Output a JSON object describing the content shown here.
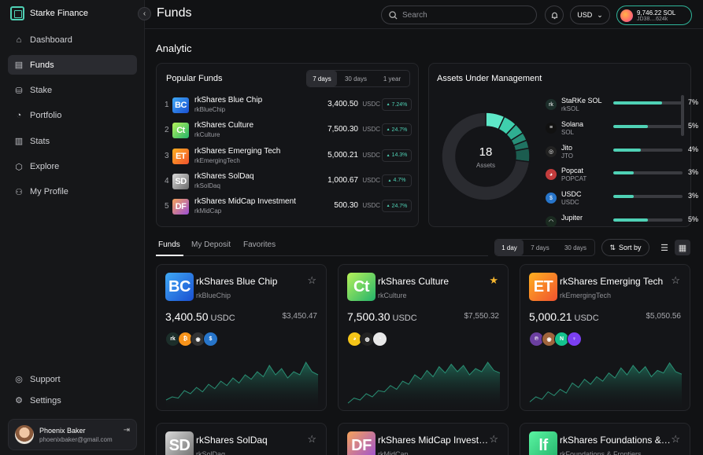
{
  "app": {
    "brand": "Starke Finance",
    "page_title": "Funds"
  },
  "sidebar": {
    "items": [
      {
        "label": "Dashboard",
        "icon": "dashboard-icon",
        "glyph": "⌂"
      },
      {
        "label": "Funds",
        "icon": "funds-icon",
        "glyph": "▤"
      },
      {
        "label": "Stake",
        "icon": "stake-icon",
        "glyph": "⛁"
      },
      {
        "label": "Portfolio",
        "icon": "portfolio-icon",
        "glyph": "◔"
      },
      {
        "label": "Stats",
        "icon": "stats-icon",
        "glyph": "▥"
      },
      {
        "label": "Explore",
        "icon": "explore-icon",
        "glyph": "⬡"
      },
      {
        "label": "My Profile",
        "icon": "profile-icon",
        "glyph": "⚇"
      }
    ],
    "bottom": [
      {
        "label": "Support",
        "icon": "support-icon",
        "glyph": "◎"
      },
      {
        "label": "Settings",
        "icon": "settings-icon",
        "glyph": "⚙"
      }
    ],
    "user": {
      "name": "Phoenix Baker",
      "email": "phoenixbaker@gmail.com"
    }
  },
  "header": {
    "search_placeholder": "Search",
    "currency": "USD",
    "wallet_balance": "9,746.22 SOL",
    "wallet_address": "JD38....624k"
  },
  "analytic": {
    "title": "Analytic"
  },
  "popular": {
    "title": "Popular Funds",
    "ranges": [
      "7 days",
      "30 days",
      "1 year"
    ],
    "active_range": 0,
    "rows": [
      {
        "rank": "1",
        "abbr": "BC",
        "name": "rkShares Blue Chip",
        "ticker": "rkBlueChip",
        "value": "3,400.50",
        "unit": "USDC",
        "change": "7.24%",
        "color": "linear-gradient(135deg,#3fa9f5,#1a4fd1)"
      },
      {
        "rank": "2",
        "abbr": "Ct",
        "name": "rkShares Culture",
        "ticker": "rkCulture",
        "value": "7,500.30",
        "unit": "USDC",
        "change": "24.7%",
        "color": "linear-gradient(135deg,#b6f25a,#24b36b)"
      },
      {
        "rank": "3",
        "abbr": "ET",
        "name": "rkShares Emerging Tech",
        "ticker": "rkEmergingTech",
        "value": "5,000.21",
        "unit": "USDC",
        "change": "14.3%",
        "color": "linear-gradient(135deg,#ffb020,#f0522f)"
      },
      {
        "rank": "4",
        "abbr": "SD",
        "name": "rkShares SolDaq",
        "ticker": "rkSolDaq",
        "value": "1,000.67",
        "unit": "USDC",
        "change": "4.7%",
        "color": "linear-gradient(135deg,#d9d9d9,#6b6b6b)"
      },
      {
        "rank": "5",
        "abbr": "DF",
        "name": "rkShares MidCap Investment",
        "ticker": "rkMidCap",
        "value": "500.30",
        "unit": "USDC",
        "change": "24.7%",
        "color": "linear-gradient(135deg,#f5a25a,#9b4fd6)"
      }
    ]
  },
  "aum": {
    "title": "Assets Under Management",
    "count": "18",
    "count_label": "Assets",
    "rows": [
      {
        "name": "StaRKe SOL",
        "ticker": "rkSOL",
        "pct": "7%",
        "share": 0.7,
        "icon": "rk-icon",
        "glyph": "rk",
        "bg": "#1c2e2a"
      },
      {
        "name": "Solana",
        "ticker": "SOL",
        "pct": "5%",
        "share": 0.5,
        "icon": "solana-icon",
        "glyph": "≡",
        "bg": "#111"
      },
      {
        "name": "Jito",
        "ticker": "JTO",
        "pct": "4%",
        "share": 0.4,
        "icon": "jito-icon",
        "glyph": "◎",
        "bg": "#222"
      },
      {
        "name": "Popcat",
        "ticker": "POPCAT",
        "pct": "3%",
        "share": 0.3,
        "icon": "popcat-icon",
        "glyph": "◕",
        "bg": "#c23c3c"
      },
      {
        "name": "USDC",
        "ticker": "USDC",
        "pct": "3%",
        "share": 0.3,
        "icon": "usdc-icon",
        "glyph": "$",
        "bg": "#2775ca"
      },
      {
        "name": "Jupiter",
        "ticker": "",
        "pct": "5%",
        "share": 0.5,
        "icon": "jupiter-icon",
        "glyph": "◠",
        "bg": "#1a2a20"
      }
    ]
  },
  "tabs": {
    "items": [
      "Funds",
      "My Deposit",
      "Favorites"
    ],
    "ranges": [
      "1 day",
      "7 days",
      "30 days"
    ],
    "sort_label": "Sort by"
  },
  "cards": [
    {
      "abbr": "BC",
      "name": "rkShares Blue Chip",
      "ticker": "rkBlueChip",
      "price": "3,400.50",
      "unit": "USDC",
      "ref": "$3,450.47",
      "fav": false,
      "color": "linear-gradient(135deg,#3fa9f5,#1a4fd1)",
      "holdings": [
        [
          "rk",
          "#1c2e2a"
        ],
        [
          "₿",
          "#f7931a"
        ],
        [
          "◉",
          "#333"
        ],
        [
          "$",
          "#2775ca"
        ]
      ],
      "trend": [
        0.15,
        0.2,
        0.18,
        0.3,
        0.25,
        0.35,
        0.28,
        0.4,
        0.33,
        0.45,
        0.38,
        0.5,
        0.42,
        0.55,
        0.48,
        0.6,
        0.52,
        0.7,
        0.55,
        0.65,
        0.5,
        0.6,
        0.55,
        0.75,
        0.6,
        0.55
      ]
    },
    {
      "abbr": "Ct",
      "name": "rkShares Culture",
      "ticker": "rkCulture",
      "price": "7,500.30",
      "unit": "USDC",
      "ref": "$7,550.32",
      "fav": true,
      "color": "linear-gradient(135deg,#b6f25a,#24b36b)",
      "holdings": [
        [
          "◕",
          "#f5c518"
        ],
        [
          "◍",
          "#222"
        ],
        [
          "◔",
          "#e8e8e8"
        ]
      ],
      "trend": [
        0.1,
        0.18,
        0.15,
        0.25,
        0.2,
        0.3,
        0.28,
        0.38,
        0.32,
        0.45,
        0.4,
        0.55,
        0.48,
        0.62,
        0.52,
        0.68,
        0.58,
        0.72,
        0.6,
        0.7,
        0.55,
        0.65,
        0.6,
        0.75,
        0.62,
        0.58
      ]
    },
    {
      "abbr": "ET",
      "name": "rkShares Emerging Tech",
      "ticker": "rkEmergingTech",
      "price": "5,000.21",
      "unit": "USDC",
      "ref": "$5,050.56",
      "fav": false,
      "color": "linear-gradient(135deg,#ffb020,#f0522f)",
      "holdings": [
        [
          "℗",
          "#6b3fa0"
        ],
        [
          "◉",
          "#a0643c"
        ],
        [
          "N",
          "#14c38e"
        ],
        [
          "♀",
          "#7b3ff2"
        ]
      ],
      "trend": [
        0.12,
        0.2,
        0.16,
        0.28,
        0.22,
        0.32,
        0.26,
        0.42,
        0.35,
        0.48,
        0.4,
        0.52,
        0.45,
        0.58,
        0.5,
        0.66,
        0.55,
        0.7,
        0.58,
        0.68,
        0.52,
        0.62,
        0.58,
        0.74,
        0.6,
        0.56
      ]
    },
    {
      "abbr": "SD",
      "name": "rkShares SolDaq",
      "ticker": "rkSolDaq",
      "price": "",
      "unit": "",
      "ref": "",
      "fav": false,
      "color": "linear-gradient(135deg,#d9d9d9,#6b6b6b)",
      "holdings": [],
      "trend": []
    },
    {
      "abbr": "DF",
      "name": "rkShares MidCap Investment",
      "ticker": "rkMidCap",
      "price": "",
      "unit": "",
      "ref": "",
      "fav": false,
      "color": "linear-gradient(135deg,#f5a25a,#9b4fd6)",
      "holdings": [],
      "trend": []
    },
    {
      "abbr": "lf",
      "name": "rkShares Foundations & Frontiers",
      "ticker": "rkFoundations & Frontiers",
      "price": "",
      "unit": "",
      "ref": "",
      "fav": false,
      "color": "linear-gradient(135deg,#5af5a2,#24b36b)",
      "holdings": [],
      "trend": []
    }
  ],
  "donut": [
    {
      "v": 7,
      "c": "#5ee8c8"
    },
    {
      "v": 5,
      "c": "#3fcfad"
    },
    {
      "v": 4,
      "c": "#2fae91"
    },
    {
      "v": 3,
      "c": "#278f78"
    },
    {
      "v": 3,
      "c": "#207362"
    },
    {
      "v": 5,
      "c": "#1b5c4f"
    },
    {
      "v": 73,
      "c": "#2a2b30"
    }
  ]
}
